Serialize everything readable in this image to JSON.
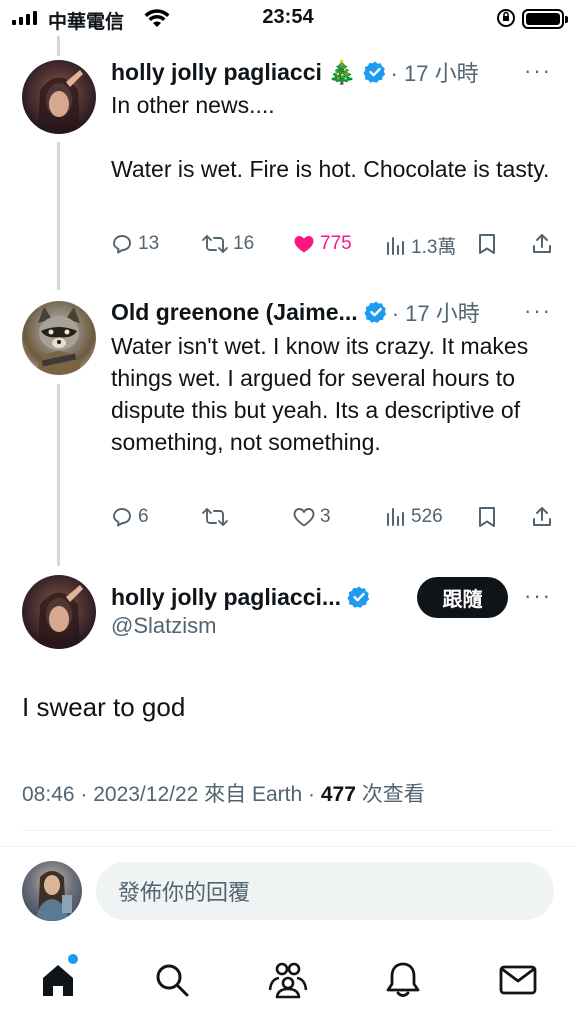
{
  "status_bar": {
    "carrier": "中華電信",
    "time": "23:54"
  },
  "tweets": [
    {
      "name": "holly jolly pagliacci",
      "name_emoji": "🎄",
      "time": "· 17 小時",
      "text": "In other news....\n\nWater is wet. Fire is hot. Chocolate is tasty.",
      "replies": "13",
      "retweets": "16",
      "likes": "775",
      "views": "1.3萬"
    },
    {
      "name": "Old greenone (Jaime...",
      "time": "· 17 小時",
      "text": "Water isn't wet. I know its crazy. It makes things wet. I argued for several hours to dispute this but yeah. Its a descriptive of something, not something.",
      "replies": "6",
      "retweets": "",
      "likes": "3",
      "views": "526"
    }
  ],
  "main_tweet": {
    "name": "holly jolly pagliacci...",
    "handle": "@Slatzism",
    "follow_label": "跟隨",
    "text": "I swear to god",
    "meta_prefix": "08:46 · 2023/12/22 來自 Earth · ",
    "view_count": "477",
    "meta_suffix": " 次查看"
  },
  "reply_bar": {
    "placeholder": "發佈你的回覆"
  },
  "colors": {
    "verified": "#1d9bf0",
    "like": "#f91880",
    "secondary": "#536471"
  }
}
